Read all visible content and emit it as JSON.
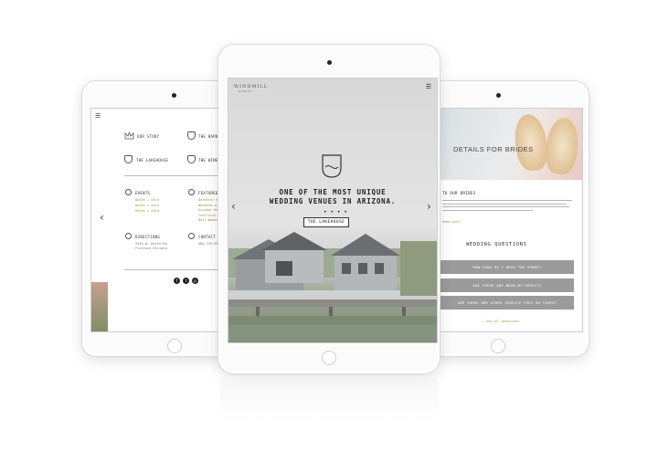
{
  "brand": {
    "logo": "WINDMILL",
    "logo_sub": "WINERY"
  },
  "left_screen": {
    "nav": [
      {
        "label": "OUR STORY",
        "icon": "crown-icon"
      },
      {
        "label": "THE BARN",
        "icon": "barn-crest-icon"
      },
      {
        "label": "THE LAKEHOUSE",
        "icon": "lakehouse-crest-icon"
      },
      {
        "label": "THE WINER",
        "icon": "winery-crest-icon"
      }
    ],
    "events": {
      "label": "EVENTS",
      "rows": [
        "Dates + Sale",
        "Dates + Sale",
        "Dates + Sale"
      ]
    },
    "featured": {
      "label": "FEATURED",
      "rows": [
        "Dardenal We",
        "Weekend an",
        "Outdoor Wed",
        "Charlotte an",
        "Barn Weddin"
      ]
    },
    "directions": {
      "label": "DIRECTIONS",
      "rows": [
        "3340 W. Butte Rd",
        "Florence Arizona"
      ]
    },
    "contact": {
      "label": "CONTACT",
      "rows": [
        "480.319.985"
      ]
    },
    "social": [
      "f",
      "t",
      "p"
    ]
  },
  "center_screen": {
    "headline_line1": "ONE OF THE MOST UNIQUE",
    "headline_line2": "WEDDING VENUES IN ARIZONA.",
    "dots": "• • • •",
    "cta": "THE LAKEHOUSE",
    "prev": "‹",
    "next": "›"
  },
  "right_screen": {
    "hero_title": "DETAILS FOR BRIDES",
    "sub": "TO OUR BRIDES",
    "link": "Read more",
    "section_title": "WEDDING QUESTIONS",
    "questions": [
      "HOW LONG DO I HAVE THE VENUE?",
      "ARE THERE ANY NEAR-BY HOTELS?",
      "ARE THERE ANY OTHER SERVICE FEES OR TAXES?"
    ],
    "more": "+ See all questions"
  },
  "colors": {
    "gold": "#a7904a",
    "question_bar": "#9b9b9b"
  }
}
